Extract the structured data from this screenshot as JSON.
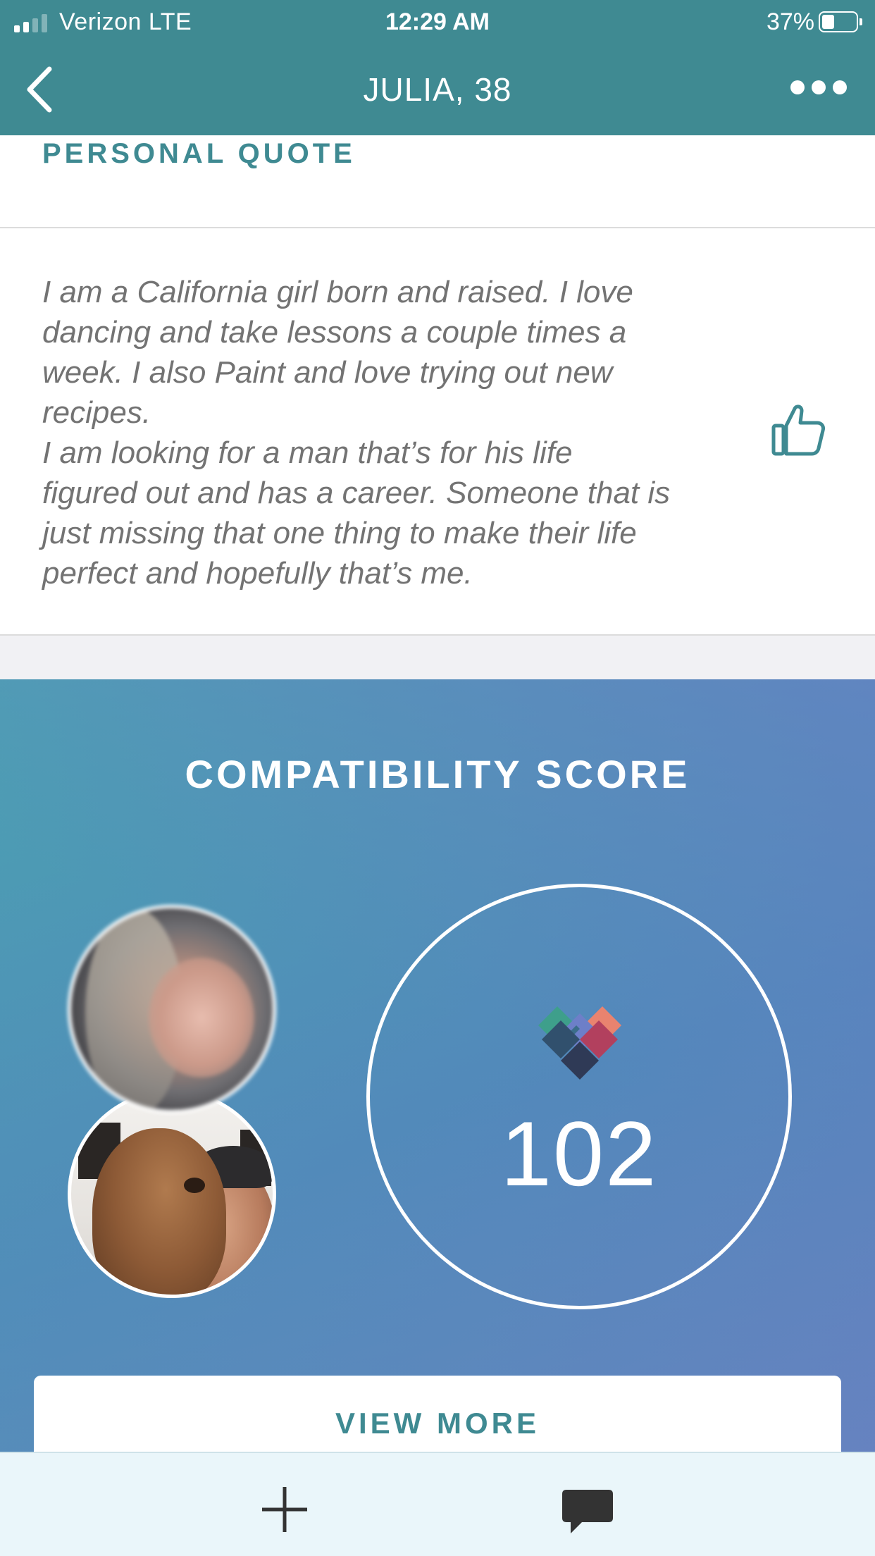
{
  "status_bar": {
    "carrier": "Verizon  LTE",
    "time": "12:29 AM",
    "battery": "37%"
  },
  "nav": {
    "title": "JULIA, 38",
    "icons": [
      "back-chevron-icon",
      "more-options-icon"
    ]
  },
  "personal_quote": {
    "heading": "PERSONAL QUOTE",
    "text": "I am a California girl born and raised. I love\ndancing and take lessons a couple times a\nweek. I also Paint and love trying out new\nrecipes.\n I am looking for a man that’s for his life\nfigured out and has a career. Someone that is\njust missing that one thing to make their life\nperfect and hopefully that’s me.",
    "like_icon": "thumbs-up-icon"
  },
  "compatibility": {
    "title": "COMPATIBILITY SCORE",
    "score": "102",
    "view_more_label": "VIEW MORE"
  },
  "tab_bar": {
    "icons": [
      "plus-icon",
      "chat-bubble-icon"
    ]
  },
  "colors": {
    "brand_teal": "#3f8a92",
    "gradient_start": "#4aa3b1",
    "gradient_end": "#6a7ec2"
  }
}
